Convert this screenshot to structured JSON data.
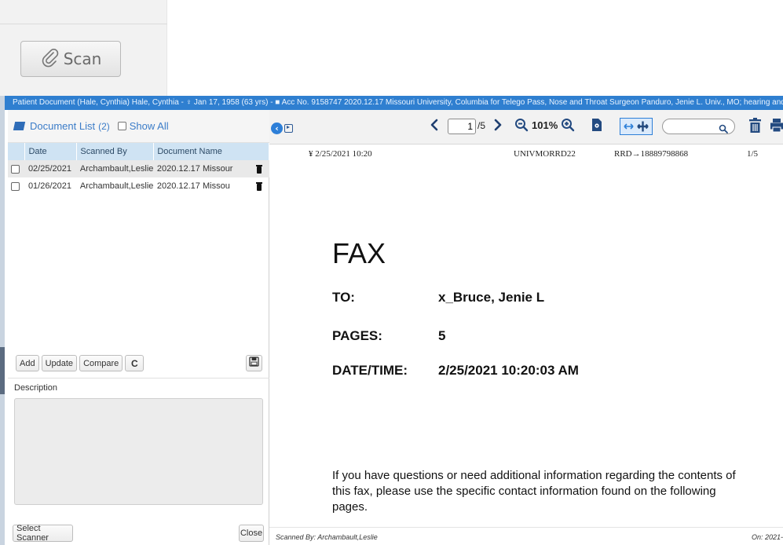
{
  "scan_button": {
    "label": "Scan",
    "icon": "paperclip-icon"
  },
  "window": {
    "title": "Patient Document (Hale, Cynthia) Hale, Cynthia - ♀ Jan 17, 1958 (63 yrs) - ■ Acc No. 9158747 2020.12.17 Missouri University, Columbia for Telego Pass, Nose and Throat Surgeon Panduro, Jenie L. Univ., MO; hearing and balance"
  },
  "document_list": {
    "title": "Document List",
    "count": "(2)",
    "show_all_label": "Show All",
    "columns": [
      "Date",
      "Scanned By",
      "Document Name"
    ],
    "rows": [
      {
        "date": "02/25/2021",
        "scanned_by": "Archambault,Leslie",
        "name": "2020.12.17 Missour"
      },
      {
        "date": "01/26/2021",
        "scanned_by": "Archambault,Leslie",
        "name": "2020.12.17 Missou"
      }
    ],
    "buttons": {
      "add": "Add",
      "update": "Update",
      "compare": "Compare",
      "refresh": "C"
    },
    "description_label": "Description",
    "select_scanner": "Select Scanner",
    "close": "Close"
  },
  "viewer": {
    "current_page": "1",
    "total_pages": "/5",
    "zoom": "101%",
    "search_placeholder": ""
  },
  "fax": {
    "header": {
      "timestamp": "2/25/2021 10:20",
      "sender": "UNIVMORRD22",
      "route": "RRD→18889798868",
      "page": "1/5"
    },
    "title": "FAX",
    "to_label": "TO:",
    "to_value": "x_Bruce, Jenie L",
    "pages_label": "PAGES:",
    "pages_value": "5",
    "datetime_label": "DATE/TIME:",
    "datetime_value": "2/25/2021 10:20:03 AM",
    "paragraph": "If you have questions or need additional information regarding the contents of this fax, please use the specific contact information found on the following pages."
  },
  "footer": {
    "scanned_by": "Scanned By: Archambault,Leslie",
    "on": "On: 2021-"
  },
  "colors": {
    "titlebar": "#2f7fd0",
    "header_row": "#cfe3f3",
    "accent": "#3b7cc8",
    "toolbar_icon": "#234a80"
  }
}
